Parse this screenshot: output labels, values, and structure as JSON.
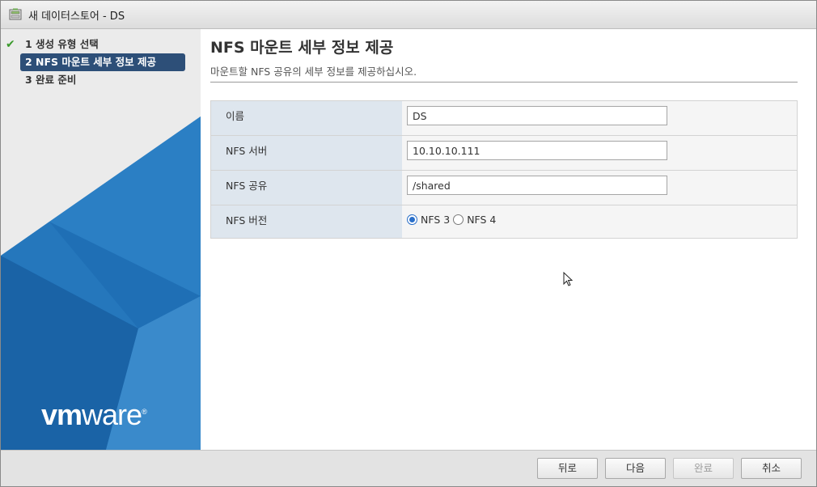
{
  "window": {
    "title": "새 데이터스토어 - DS"
  },
  "nav": {
    "steps": [
      {
        "label": "1 생성 유형 선택",
        "state": "completed"
      },
      {
        "label": "2 NFS 마운트 세부 정보 제공",
        "state": "active"
      },
      {
        "label": "3 완료 준비",
        "state": "pending"
      }
    ],
    "logo": {
      "part1": "vm",
      "part2": "ware"
    }
  },
  "main": {
    "title": "NFS 마운트 세부 정보 제공",
    "description": "마운트할 NFS 공유의 세부 정보를 제공하십시오.",
    "fields": {
      "name": {
        "label": "이름",
        "value": "DS"
      },
      "server": {
        "label": "NFS 서버",
        "value": "10.10.10.111"
      },
      "share": {
        "label": "NFS 공유",
        "value": "/shared"
      },
      "version": {
        "label": "NFS 버전",
        "options": [
          {
            "label": "NFS 3",
            "selected": true
          },
          {
            "label": "NFS 4",
            "selected": false
          }
        ]
      }
    }
  },
  "footer": {
    "back": "뒤로",
    "next": "다음",
    "finish": "완료",
    "cancel": "취소"
  },
  "colors": {
    "active_step_bg": "#2d4f78",
    "check_green": "#3a9a2b",
    "brand_blue": "#1f6fb5"
  }
}
